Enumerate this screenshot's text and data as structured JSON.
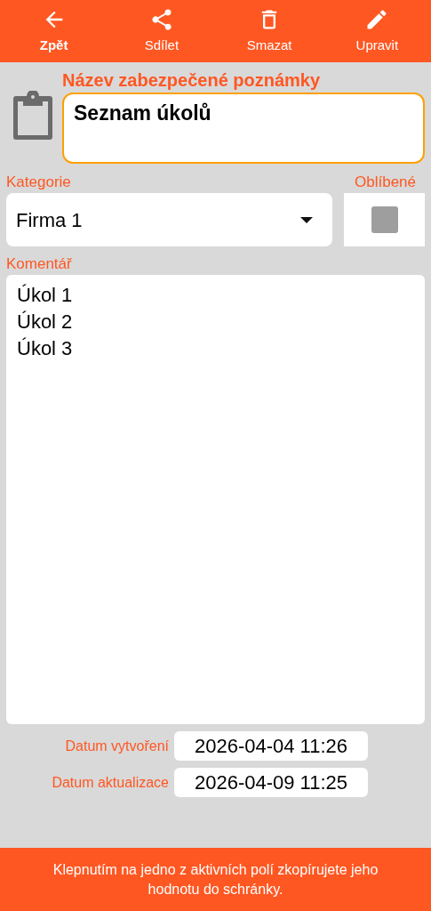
{
  "toolbar": [
    {
      "kind": "back",
      "label": "Zpět",
      "emphasized": true
    },
    {
      "kind": "share",
      "label": "Sdílet",
      "emphasized": false
    },
    {
      "kind": "delete",
      "label": "Smazat",
      "emphasized": false
    },
    {
      "kind": "edit",
      "label": "Upravit",
      "emphasized": false
    }
  ],
  "title": {
    "label": "Název zabezpečené poznámky",
    "value": "Seznam úkolů"
  },
  "category": {
    "label": "Kategorie",
    "value": "Firma 1"
  },
  "favorite": {
    "label": "Oblíbené",
    "checked": false
  },
  "comment": {
    "label": "Komentář",
    "lines": [
      "Úkol 1",
      "Úkol 2",
      "Úkol 3"
    ]
  },
  "dates": [
    {
      "label": "Datum vytvoření",
      "value": "2026-04-04 11:26"
    },
    {
      "label": "Datum aktualizace",
      "value": "2026-04-09 11:25"
    }
  ],
  "footer": "Klepnutím na jedno z aktivních polí zkopírujete jeho hodnotu do schránky."
}
